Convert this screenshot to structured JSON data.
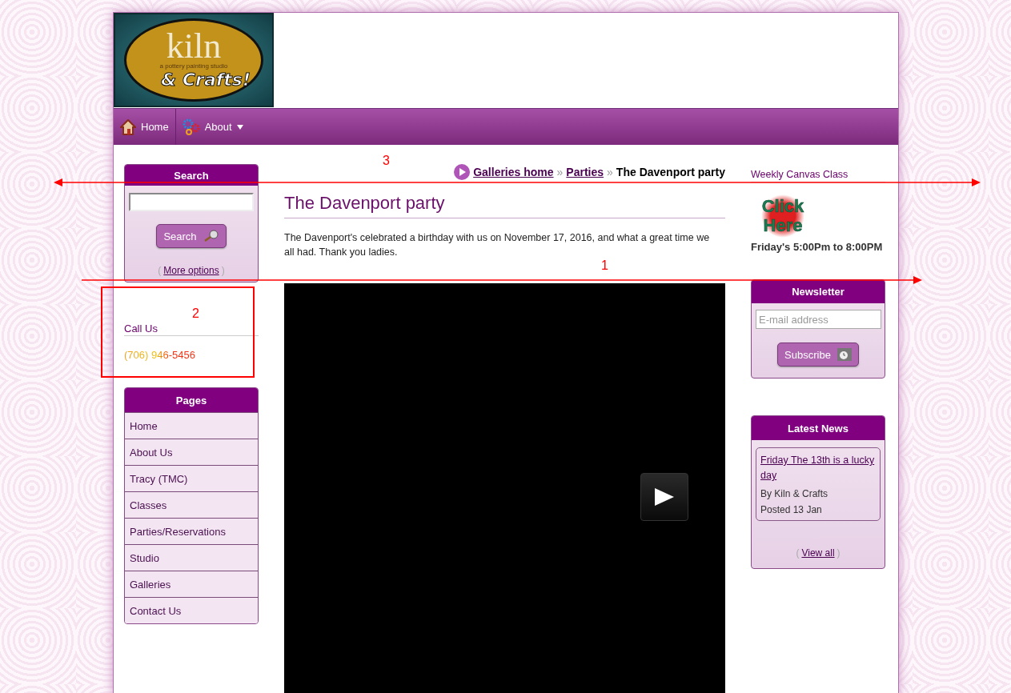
{
  "logo": {
    "title": "kiln",
    "tagline": "a pottery painting studio",
    "subtitle": "& Crafts!"
  },
  "nav": [
    {
      "label": "Home",
      "kind": "house",
      "dropdown": false
    },
    {
      "label": "About",
      "kind": "gears",
      "dropdown": true
    }
  ],
  "search": {
    "title": "Search",
    "button": "Search",
    "more": {
      "open": "(",
      "link": "More options",
      "close": ")"
    }
  },
  "call_us": {
    "title": "Call Us",
    "phone": "(706) 946-5456"
  },
  "pages": {
    "title": "Pages",
    "items": [
      "Home",
      "About Us",
      "Tracy (TMC)",
      "Classes",
      "Parties/Reservations",
      "Studio",
      "Galleries",
      "Contact Us"
    ]
  },
  "breadcrumb": {
    "links": [
      "Galleries home",
      "Parties"
    ],
    "separator": "»",
    "current": "The Davenport party"
  },
  "article": {
    "title": "The Davenport party",
    "body": "The Davenport's celebrated a birthday with us on November 17, 2016, and what a great time we all had. Thank you ladies."
  },
  "canvas_class": {
    "title": "Weekly Canvas Class",
    "image_text": [
      "Click",
      "Here"
    ],
    "schedule": "Friday's 5:00Pm to 8:00PM"
  },
  "newsletter": {
    "title": "Newsletter",
    "placeholder": "E-mail address",
    "button": "Subscribe"
  },
  "news": {
    "title": "Latest News",
    "items": [
      {
        "headline": "Friday The 13th is a lucky day",
        "author": "By Kiln & Crafts",
        "posted": "Posted 13 Jan"
      }
    ],
    "view_all": {
      "open": "(",
      "link": "View all",
      "close": ")"
    }
  },
  "annotations": [
    {
      "kind": "arrow",
      "label": "3"
    },
    {
      "kind": "arrow",
      "label": "1"
    },
    {
      "kind": "box",
      "label": "2"
    }
  ]
}
